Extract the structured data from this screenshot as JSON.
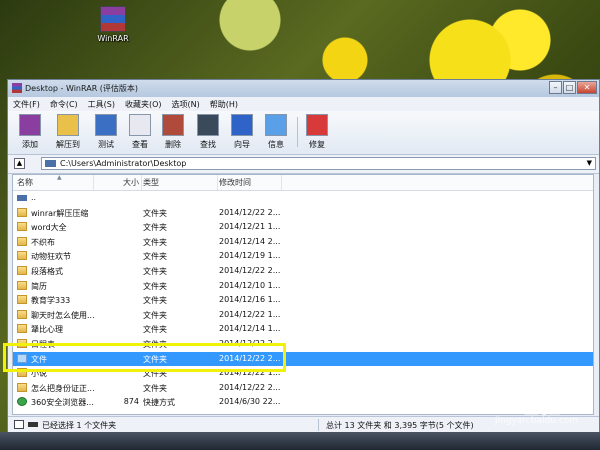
{
  "desktop": {
    "icon_label": "WinRAR"
  },
  "window": {
    "title": "Desktop - WinRAR (评估版本)",
    "minimize": "–",
    "maximize": "□",
    "close": "✕"
  },
  "menu": [
    "文件(F)",
    "命令(C)",
    "工具(S)",
    "收藏夹(O)",
    "选项(N)",
    "帮助(H)"
  ],
  "toolbar": [
    {
      "label": "添加",
      "icon": "add-archive-icon",
      "color": "#8a3fa0"
    },
    {
      "label": "解压到",
      "icon": "extract-to-icon",
      "color": "#e8c04a"
    },
    {
      "label": "测试",
      "icon": "test-icon",
      "color": "#3b6fc4"
    },
    {
      "label": "查看",
      "icon": "view-icon",
      "color": "#e8e8f0"
    },
    {
      "label": "删除",
      "icon": "delete-icon",
      "color": "#b04a3a"
    },
    {
      "label": "查找",
      "icon": "find-icon",
      "color": "#3a4a5a"
    },
    {
      "label": "向导",
      "icon": "wizard-icon",
      "color": "#2f63c7"
    },
    {
      "label": "信息",
      "icon": "info-icon",
      "color": "#5aa0e8"
    },
    {
      "label": "修复",
      "icon": "repair-icon",
      "color": "#d83a3a"
    }
  ],
  "address": {
    "path": "C:\\Users\\Administrator\\Desktop"
  },
  "columns": {
    "name": "名称",
    "size": "大小",
    "type": "类型",
    "modified": "修改时间"
  },
  "rows": [
    {
      "name": "..",
      "size": "",
      "type": "",
      "date": "",
      "kind": "up"
    },
    {
      "name": "winrar解压压缩",
      "size": "",
      "type": "文件夹",
      "date": "2014/12/22 2...",
      "kind": "folder"
    },
    {
      "name": "word大全",
      "size": "",
      "type": "文件夹",
      "date": "2014/12/21 1...",
      "kind": "folder"
    },
    {
      "name": "不织布",
      "size": "",
      "type": "文件夹",
      "date": "2014/12/14 2...",
      "kind": "folder"
    },
    {
      "name": "动物狂欢节",
      "size": "",
      "type": "文件夹",
      "date": "2014/12/19 1...",
      "kind": "folder"
    },
    {
      "name": "段落格式",
      "size": "",
      "type": "文件夹",
      "date": "2014/12/22 2...",
      "kind": "folder"
    },
    {
      "name": "简历",
      "size": "",
      "type": "文件夹",
      "date": "2014/12/10 1...",
      "kind": "folder"
    },
    {
      "name": "教育学333",
      "size": "",
      "type": "文件夹",
      "date": "2014/12/16 1...",
      "kind": "folder"
    },
    {
      "name": "聊天时怎么使用...",
      "size": "",
      "type": "文件夹",
      "date": "2014/12/22 1...",
      "kind": "folder"
    },
    {
      "name": "犟比心理",
      "size": "",
      "type": "文件夹",
      "date": "2014/12/14 1...",
      "kind": "folder"
    },
    {
      "name": "日程表",
      "size": "",
      "type": "文件夹",
      "date": "2014/12/22 2...",
      "kind": "folder"
    },
    {
      "name": "文件",
      "size": "",
      "type": "文件夹",
      "date": "2014/12/22 2...",
      "kind": "folder",
      "selected": true
    },
    {
      "name": "小说",
      "size": "",
      "type": "文件夹",
      "date": "2014/12/22 1...",
      "kind": "folder"
    },
    {
      "name": "怎么把身份证正...",
      "size": "",
      "type": "文件夹",
      "date": "2014/12/22 2...",
      "kind": "folder"
    },
    {
      "name": "360安全浏览器...",
      "size": "874",
      "type": "快捷方式",
      "date": "2014/6/30 22...",
      "kind": "shortcut"
    }
  ],
  "status": {
    "left": "已经选择 1 个文件夹",
    "right": "总计 13 文件夹 和 3,395 字节(5 个文件)"
  },
  "watermark": {
    "text": "Bai 经验",
    "url": "jingyan.baidu.com"
  }
}
